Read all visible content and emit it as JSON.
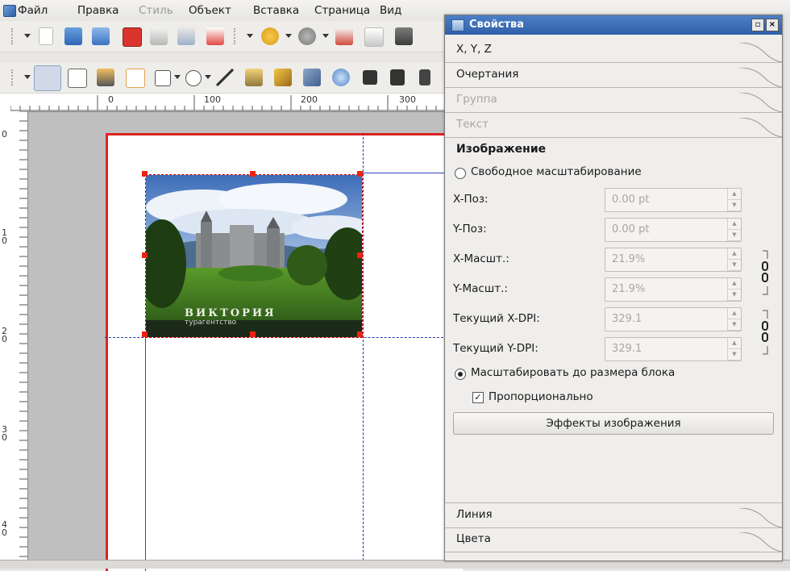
{
  "menubar": {
    "items": [
      {
        "label": "Файл",
        "disabled": false
      },
      {
        "label": "Правка",
        "disabled": false
      },
      {
        "label": "Стиль",
        "disabled": true
      },
      {
        "label": "Объект",
        "disabled": false
      },
      {
        "label": "Вставка",
        "disabled": false
      },
      {
        "label": "Страница",
        "disabled": false
      },
      {
        "label": "Вид",
        "disabled": false
      }
    ]
  },
  "rulers": {
    "h_labels": [
      "0",
      "100",
      "200",
      "300"
    ],
    "v_labels": [
      "0",
      "10",
      "20",
      "30",
      "40"
    ]
  },
  "document": {
    "image_brand_title": "ВИКТОРИЯ",
    "image_brand_sub": "турагентство"
  },
  "panel": {
    "title": "Свойства",
    "sections_top": [
      {
        "label": "X, Y, Z",
        "disabled": false
      },
      {
        "label": "Очертания",
        "disabled": false
      },
      {
        "label": "Группа",
        "disabled": true
      },
      {
        "label": "Текст",
        "disabled": true
      }
    ],
    "image_section": {
      "label": "Изображение",
      "free_scaling_label": "Свободное масштабирование",
      "free_scaling_selected": false,
      "fields": [
        {
          "label": "X-Поз:",
          "value": "0.00 pt"
        },
        {
          "label": "Y-Поз:",
          "value": "0.00 pt"
        },
        {
          "label": "X-Масшт.:",
          "value": "21.9%"
        },
        {
          "label": "Y-Масшт.:",
          "value": "21.9%"
        },
        {
          "label": "Текущий X-DPI:",
          "value": "329.1"
        },
        {
          "label": "Текущий Y-DPI:",
          "value": "329.1"
        }
      ],
      "fit_frame_label": "Масштабировать до размера блока",
      "fit_frame_selected": true,
      "proportional_label": "Пропорционально",
      "proportional_checked": true,
      "effects_button": "Эффекты изображения"
    },
    "sections_bottom": [
      {
        "label": "Линия"
      },
      {
        "label": "Цвета"
      }
    ]
  }
}
